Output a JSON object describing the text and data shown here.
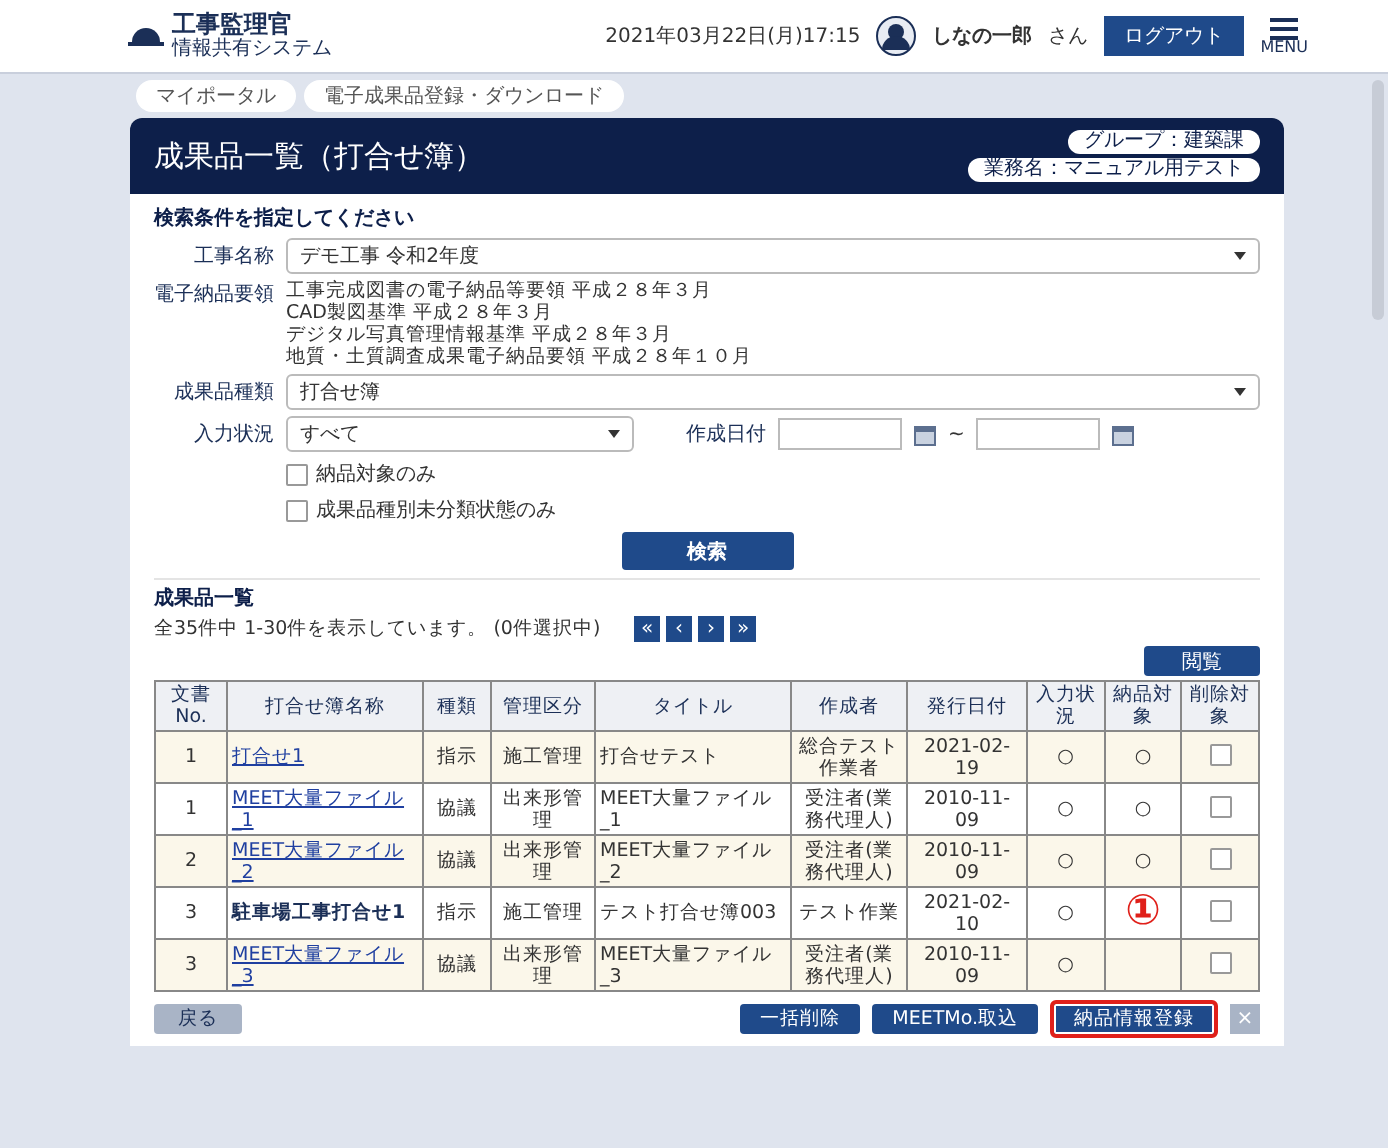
{
  "header": {
    "logo_title": "工事監理官",
    "logo_subtitle": "情報共有システム",
    "datetime": "2021年03月22日(月)17:15",
    "user_name": "しなの一郎",
    "user_suffix": "さん",
    "logout": "ログアウト",
    "menu": "MENU"
  },
  "breadcrumb": [
    "マイポータル",
    "電子成果品登録・ダウンロード"
  ],
  "title": "成果品一覧（打合せ簿）",
  "badges": [
    "グループ：建築課",
    "業務名：マニュアル用テスト"
  ],
  "search": {
    "heading": "検索条件を指定してください",
    "project": {
      "label": "工事名称",
      "value": "デモ工事 令和2年度"
    },
    "standards": {
      "label": "電子納品要領",
      "lines": [
        "工事完成図書の電子納品等要領 平成２８年３月",
        "CAD製図基準 平成２８年３月",
        "デジタル写真管理情報基準 平成２８年３月",
        "地質・土質調査成果電子納品要領 平成２８年１０月"
      ]
    },
    "type": {
      "label": "成果品種類",
      "value": "打合せ簿"
    },
    "status": {
      "label": "入力状況",
      "value": "すべて"
    },
    "date": {
      "label": "作成日付",
      "separator": "~"
    },
    "checkboxes": [
      {
        "label": "納品対象のみ",
        "checked": false
      },
      {
        "label": "成果品種別未分類状態のみ",
        "checked": false
      }
    ],
    "button": "検索"
  },
  "list": {
    "heading": "成果品一覧",
    "count": "全35件中 1-30件を表示しています。 (0件選択中)",
    "pager": [
      "«",
      "‹",
      "›",
      "»"
    ],
    "view_button": "閲覧"
  },
  "table": {
    "columns": [
      "文書No.",
      "打合せ簿名称",
      "種類",
      "管理区分",
      "タイトル",
      "作成者",
      "発行日付",
      "入力状況",
      "納品対象",
      "削除対象"
    ],
    "rows": [
      {
        "no": "1",
        "name": "打合せ1",
        "link": true,
        "kind": "指示",
        "category": "施工管理",
        "title": "打合せテスト",
        "author": "総合テスト作業者",
        "date": "2021-02-19",
        "input": "○",
        "delivery": "○",
        "delete": false
      },
      {
        "no": "1",
        "name": "MEET大量ファイル_1",
        "link": true,
        "kind": "協議",
        "category": "出来形管理",
        "title": "MEET大量ファイル_1",
        "author": "受注者(業務代理人)",
        "date": "2010-11-09",
        "input": "○",
        "delivery": "○",
        "delete": false
      },
      {
        "no": "2",
        "name": "MEET大量ファイル_2",
        "link": true,
        "kind": "協議",
        "category": "出来形管理",
        "title": "MEET大量ファイル_2",
        "author": "受注者(業務代理人)",
        "date": "2010-11-09",
        "input": "○",
        "delivery": "○",
        "delete": false
      },
      {
        "no": "3",
        "name": "駐車場工事打合せ1",
        "link": false,
        "kind": "指示",
        "category": "施工管理",
        "title": "テスト打合せ簿003",
        "author": "テスト作業",
        "date": "2021-02-10",
        "input": "○",
        "delete": false
      },
      {
        "no": "3",
        "name": "MEET大量ファイル_3",
        "link": true,
        "kind": "協議",
        "category": "出来形管理",
        "title": "MEET大量ファイル_3",
        "author": "受注者(業務代理人)",
        "date": "2010-11-09",
        "input": "○",
        "delete": false
      }
    ]
  },
  "annotation": "①",
  "footer": {
    "back": "戻る",
    "buttons": [
      {
        "label": "一括削除",
        "highlighted": false
      },
      {
        "label": "MEETMo.取込",
        "highlighted": false
      },
      {
        "label": "納品情報登録",
        "highlighted": true
      }
    ],
    "close": "×"
  }
}
